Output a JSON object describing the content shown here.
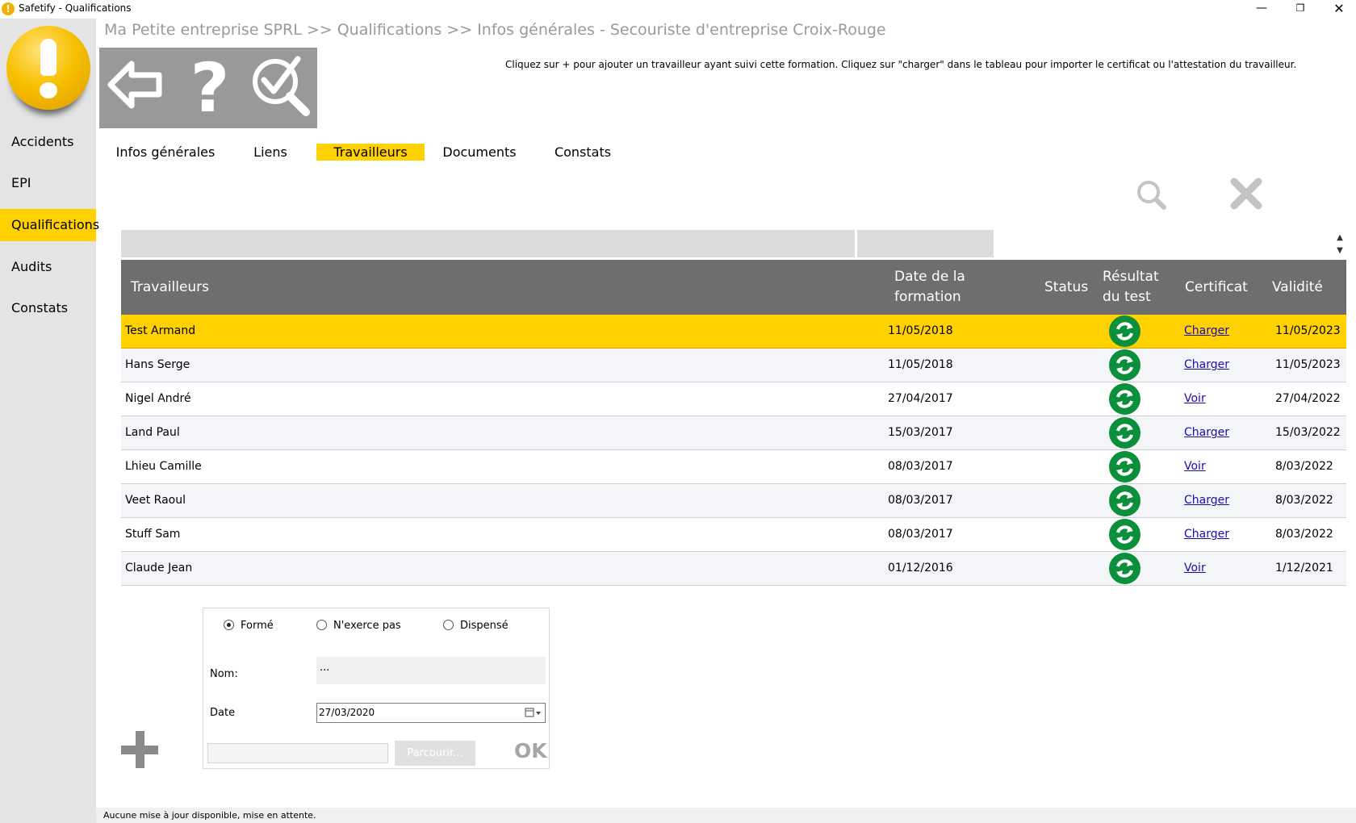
{
  "window": {
    "title": "Safetify - Qualifications",
    "minimize": "—",
    "maximize": "❐",
    "close": "✕"
  },
  "sidebar": {
    "items": [
      {
        "label": "Accidents"
      },
      {
        "label": "EPI"
      },
      {
        "label": "Qualifications",
        "active": true
      },
      {
        "label": "Audits"
      },
      {
        "label": "Constats"
      }
    ]
  },
  "breadcrumb": "Ma Petite entreprise SPRL >> Qualifications >> Infos générales - Secouriste d'entreprise Croix-Rouge",
  "toolbar": {
    "back_icon": "back-arrow-icon",
    "help_label": "?",
    "check_icon": "search-check-icon"
  },
  "hint": "Cliquez sur + pour ajouter un travailleur ayant suivi cette formation. Cliquez sur \"charger\" dans le tableau pour importer le certificat ou l'attestation du travailleur.",
  "tabs": [
    {
      "label": "Infos générales"
    },
    {
      "label": "Liens"
    },
    {
      "label": "Travailleurs",
      "active": true
    },
    {
      "label": "Documents"
    },
    {
      "label": "Constats"
    }
  ],
  "scroll": {
    "up": "▲",
    "down": "▼"
  },
  "table": {
    "headers": {
      "workers": "Travailleurs",
      "date_1": "Date de la",
      "date_2": "formation",
      "status": "Status",
      "result_1": "Résultat",
      "result_2": "du test",
      "certificate": "Certificat",
      "validity": "Validité"
    },
    "rows": [
      {
        "name": "Test Armand",
        "date": "11/05/2018",
        "cert": "Charger",
        "validity": "11/05/2023"
      },
      {
        "name": "Hans Serge",
        "date": "11/05/2018",
        "cert": "Charger",
        "validity": "11/05/2023"
      },
      {
        "name": "Nigel André",
        "date": "27/04/2017",
        "cert": "Voir",
        "validity": "27/04/2022"
      },
      {
        "name": "Land Paul",
        "date": "15/03/2017",
        "cert": "Charger",
        "validity": "15/03/2022"
      },
      {
        "name": "Lhieu Camille",
        "date": "08/03/2017",
        "cert": "Voir",
        "validity": "8/03/2022"
      },
      {
        "name": "Veet Raoul",
        "date": "08/03/2017",
        "cert": "Charger",
        "validity": "8/03/2022"
      },
      {
        "name": "Stuff Sam",
        "date": "08/03/2017",
        "cert": "Charger",
        "validity": "8/03/2022"
      },
      {
        "name": "Claude Jean",
        "date": "01/12/2016",
        "cert": "Voir",
        "validity": "1/12/2021"
      }
    ]
  },
  "form": {
    "radio_trained": "Formé",
    "radio_not_practicing": "N'exerce pas",
    "radio_exempted": "Dispensé",
    "selected": "Formé",
    "name_label": "Nom:",
    "name_value": "...",
    "date_label": "Date",
    "date_value": "27/03/2020",
    "browse_label": "Parcourir...",
    "ok_label": "OK"
  },
  "status_bar": "Aucune mise à jour disponible, mise en attente.",
  "colors": {
    "accent": "#ffd100",
    "sidebar_bg": "#e4e4e4",
    "toolbar_bg": "#999999",
    "header_bg": "#6e6e6e",
    "status_green": "#0b8f3a",
    "link": "#1a0dab"
  }
}
